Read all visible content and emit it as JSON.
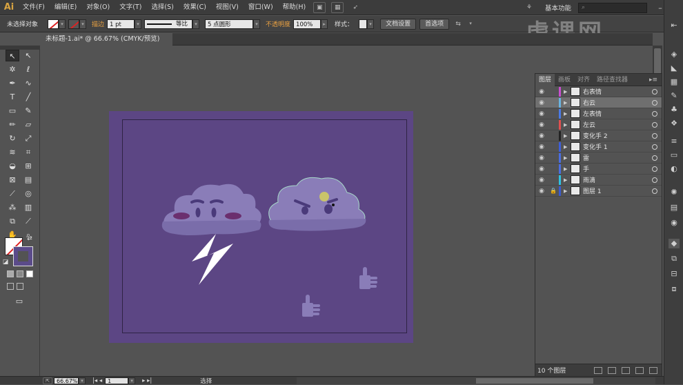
{
  "app": {
    "logo": "Ai"
  },
  "menubar": {
    "items": [
      "文件(F)",
      "编辑(E)",
      "对象(O)",
      "文字(T)",
      "选择(S)",
      "效果(C)",
      "视图(V)",
      "窗口(W)",
      "帮助(H)"
    ],
    "workspace": "基本功能",
    "search_placeholder": ""
  },
  "control": {
    "selection": "未选择对象",
    "stroke_label": "描边",
    "stroke_weight": "1 pt",
    "profile": "等比",
    "brush": "5 点圆形",
    "opacity_label": "不透明度",
    "opacity_value": "100%",
    "style_label": "样式：",
    "doc_setup": "文档设置",
    "preferences": "首选项"
  },
  "document": {
    "tab_title": "未标题-1.ai* @ 66.67% (CMYK/预览)",
    "close": "×"
  },
  "layers_panel": {
    "tabs": [
      "图层",
      "画板",
      "对齐",
      "路径查找器"
    ],
    "rows": [
      {
        "name": "右表情",
        "color": "#c94fd0",
        "selected": false
      },
      {
        "name": "右云",
        "color": "#6bb4e0",
        "selected": true
      },
      {
        "name": "左表情",
        "color": "#4a7ae6",
        "selected": false
      },
      {
        "name": "左云",
        "color": "#e05050",
        "selected": false
      },
      {
        "name": "变化手 2",
        "color": "#222222",
        "selected": false
      },
      {
        "name": "变化手 1",
        "color": "#3e5fd9",
        "selected": false
      },
      {
        "name": "雷",
        "color": "#4a6ee0",
        "selected": false
      },
      {
        "name": "手",
        "color": "#4a6ee0",
        "selected": false
      },
      {
        "name": "雨滴",
        "color": "#2fc2e0",
        "selected": false
      },
      {
        "name": "图层 1",
        "color": "#3b5bcf",
        "selected": false
      }
    ],
    "footer_count": "10 个图层"
  },
  "status": {
    "zoom": "66.67%",
    "artboard": "1",
    "tool": "选择"
  },
  "watermark": "虎课网",
  "colors": {
    "artboard": "#5c4684",
    "cloud": "#8a7db8",
    "cheek": "#6b2f6e"
  }
}
